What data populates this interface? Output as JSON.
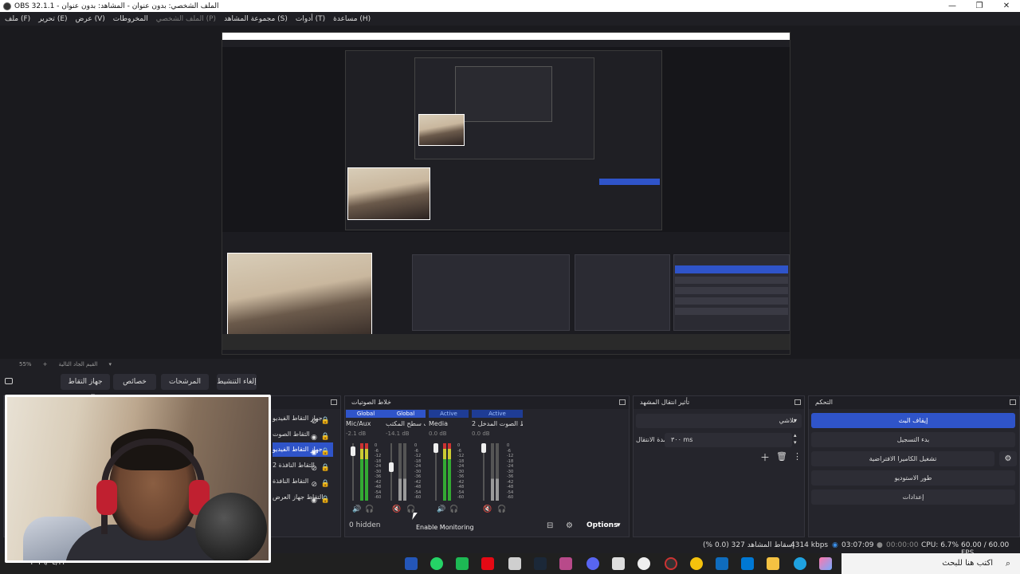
{
  "window": {
    "title": "OBS 32.1.1 - الملف الشخصي: بدون عنوان - المشاهد: بدون عنوان",
    "controls": [
      "—",
      "❐",
      "✕"
    ]
  },
  "menu": {
    "items": [
      "ملف (F)",
      "تحرير (E)",
      "عرض (V)",
      "المخروطات",
      "الملف الشخصي (P)",
      "مجموعة المشاهد (S)",
      "أدوات (T)",
      "مساعدة (H)"
    ]
  },
  "zoom": {
    "level": "55%",
    "scene_label": "القيم الجاد التالية"
  },
  "source_toolbar": {
    "deactivate": "إلغاء التنشيط",
    "filters": "المرشحات",
    "properties": "خصائص",
    "source_name": "جهاز التقاط الفيديو"
  },
  "sources": {
    "items": [
      {
        "label": "جهاز التقاط الفيديو"
      },
      {
        "label": "التقاط الصوت"
      },
      {
        "label": "جهاز التقاط الفيديو"
      },
      {
        "label": "التقاط النافذة 2"
      },
      {
        "label": "التقاط النافذة"
      },
      {
        "label": "التقاط جهاز العرض"
      }
    ]
  },
  "mixer": {
    "title": "خلاط الصوتيات",
    "channels": [
      {
        "badge": "Global",
        "name": "Mic/Aux",
        "db": "-2.1 dB"
      },
      {
        "badge": "Global",
        "name": "صوت سطح المكتب",
        "db": "-14.1 dB"
      },
      {
        "badge": "Active",
        "name": "Media",
        "db": "0.0 dB"
      },
      {
        "badge": "Active",
        "name": "التقاط الصوت المدخل 2",
        "db": "0.0 dB"
      }
    ],
    "scale": [
      "0",
      "-6",
      "-12",
      "-18",
      "-24",
      "-30",
      "-36",
      "-42",
      "-48",
      "-54",
      "-60"
    ],
    "hidden": "0 hidden",
    "options": "Options",
    "tooltip": "Enable Monitoring"
  },
  "transitions": {
    "title": "تأثير انتقال المشهد",
    "selected": "تلاشي",
    "duration_label": "مدة الانتقال",
    "duration_value": "٣٠٠ ms"
  },
  "controls": {
    "title": "التحكم",
    "stop_stream": "إيقاف البث",
    "start_record": "بدء التسجيل",
    "virtual_cam": "تشغيل الكاميرا الافتراضية",
    "studio_mode": "طور الاستوديو",
    "settings": "إعدادات"
  },
  "status": {
    "dropped": "إسقاط المشاهد 327 (0.0 %)",
    "kbps": "4314 kbps",
    "stream_time": "03:07:09",
    "rec_time": "00:00:00",
    "cpu": "CPU: 6.7%",
    "fps": "60.00 / 60.00 FPS"
  },
  "taskbar": {
    "search_placeholder": "اكتب هنا للبحث",
    "date": "٢٠٢٦/٠٤/٢٢"
  },
  "colors": {
    "accent": "#2f54c9",
    "bg": "#1f1f24",
    "panel": "#25252c"
  }
}
